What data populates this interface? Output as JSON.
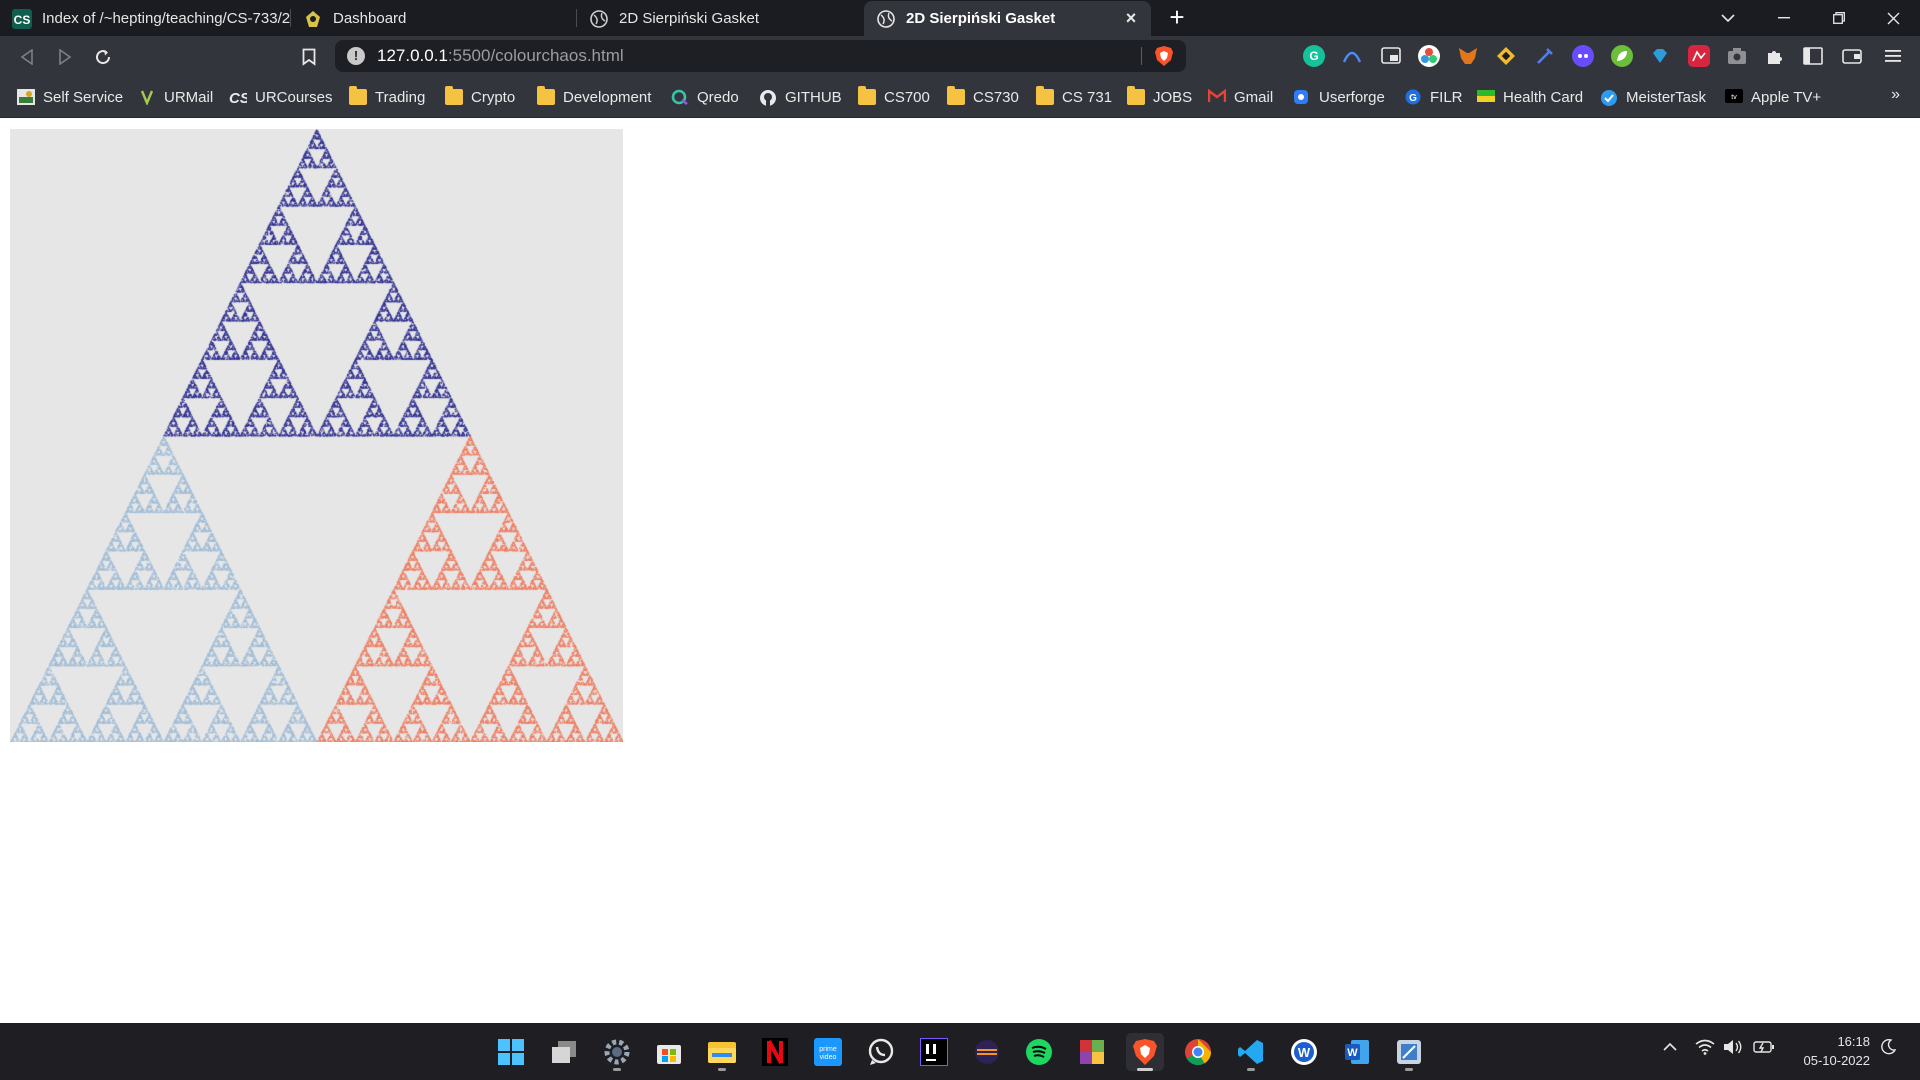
{
  "browser": {
    "tabs": [
      {
        "title": "Index of /~hepting/teaching/CS-733/2",
        "favicon": "cs-icon",
        "active": false
      },
      {
        "title": "Dashboard",
        "favicon": "urcourses-icon",
        "active": false
      },
      {
        "title": "2D Sierpiński Gasket",
        "favicon": "globe-icon",
        "active": false
      },
      {
        "title": "2D Sierpiński Gasket",
        "favicon": "globe-icon",
        "active": true
      }
    ],
    "url": {
      "host": "127.0.0.1",
      "path": ":5500/colourchaos.html"
    },
    "bookmarks": [
      {
        "label": "Self Service",
        "icon": "self-service-icon"
      },
      {
        "label": "URMail",
        "icon": "urmail-icon"
      },
      {
        "label": "URCourses",
        "icon": "urcourses-icon"
      },
      {
        "label": "Trading",
        "icon": "folder-icon"
      },
      {
        "label": "Crypto",
        "icon": "folder-icon"
      },
      {
        "label": "Development",
        "icon": "folder-icon"
      },
      {
        "label": "Qredo",
        "icon": "qredo-icon"
      },
      {
        "label": "GITHUB",
        "icon": "github-icon"
      },
      {
        "label": "CS700",
        "icon": "folder-icon"
      },
      {
        "label": "CS730",
        "icon": "folder-icon"
      },
      {
        "label": "CS 731",
        "icon": "folder-icon"
      },
      {
        "label": "JOBS",
        "icon": "folder-icon"
      },
      {
        "label": "Gmail",
        "icon": "gmail-icon"
      },
      {
        "label": "Userforge",
        "icon": "userforge-icon"
      },
      {
        "label": "FILR",
        "icon": "filr-icon"
      },
      {
        "label": "Health Card",
        "icon": "health-card-icon"
      },
      {
        "label": "MeisterTask",
        "icon": "meistertask-icon"
      },
      {
        "label": "Apple TV+",
        "icon": "appletv-icon"
      }
    ],
    "bookmarks_overflow": "»",
    "more_icon": "chevron-down-icon"
  },
  "page": {
    "canvas_description_colors": {
      "background": "#e6e6e6",
      "top_triangle": "#2d2d8f",
      "left_triangle": "#9ebbd6",
      "right_triangle": "#ee7a5d"
    }
  },
  "taskbar": {
    "apps": [
      "windows-start-icon",
      "task-view-icon",
      "settings-icon",
      "microsoft-store-icon",
      "file-explorer-icon",
      "netflix-icon",
      "prime-video-icon",
      "whatsapp-icon",
      "intellij-icon",
      "eclipse-icon",
      "spotify-icon",
      "minecraft-icon",
      "brave-icon",
      "chrome-icon",
      "vscode-icon",
      "teams-w-icon",
      "word-icon",
      "snipping-tool-icon"
    ],
    "time": "16:18",
    "date": "05-10-2022"
  }
}
